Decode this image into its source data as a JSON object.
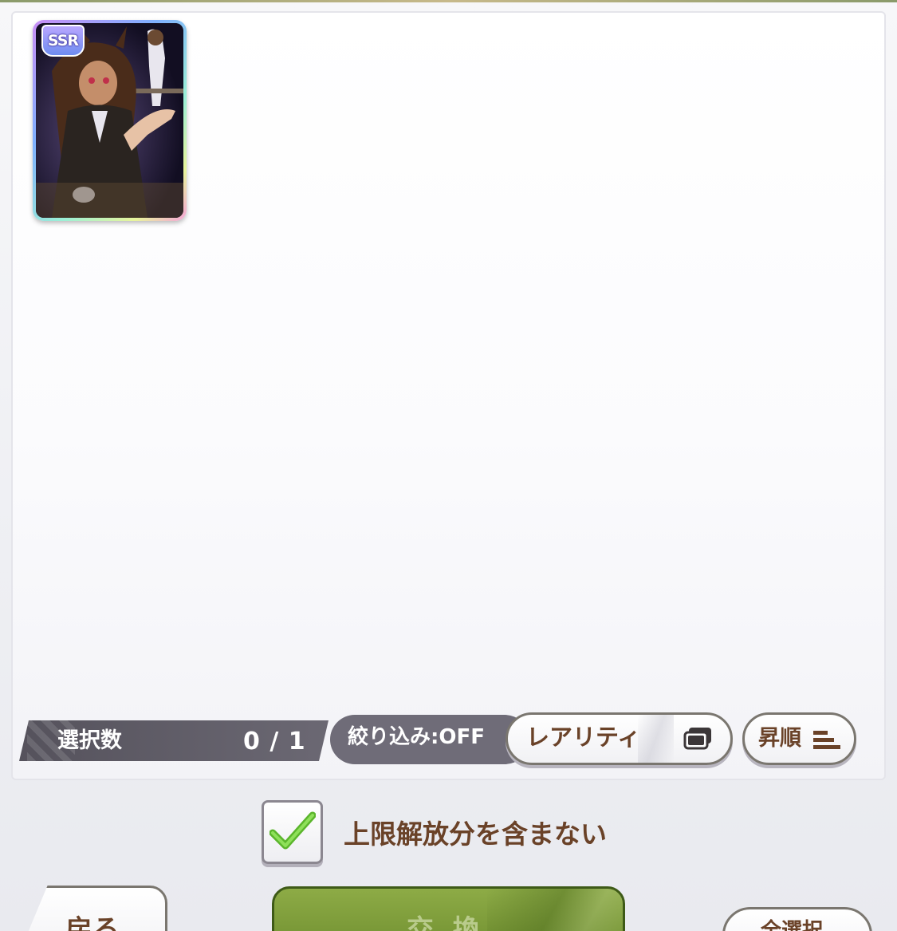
{
  "card": {
    "rarity": "SSR",
    "frame_colors": [
      "#c98ff5",
      "#7fb0ff",
      "#9bf0d6",
      "#e8f59b"
    ]
  },
  "selection": {
    "label": "選択数",
    "value": "0 / 1"
  },
  "filter": {
    "label": "絞り込み:OFF"
  },
  "sort": {
    "rarity_label": "レアリティ",
    "order_label": "昇順",
    "stack_icon": "card-stack-icon",
    "order_icon": "sort-order-icon"
  },
  "option": {
    "checked": true,
    "label": "上限解放分を含まない"
  },
  "buttons": {
    "back": "戻る",
    "exchange": "交換",
    "select_all": "全選択"
  },
  "colors": {
    "text_brown": "#6a4228",
    "exchange_green": "#7a9a36",
    "check_green": "#6cc238"
  }
}
